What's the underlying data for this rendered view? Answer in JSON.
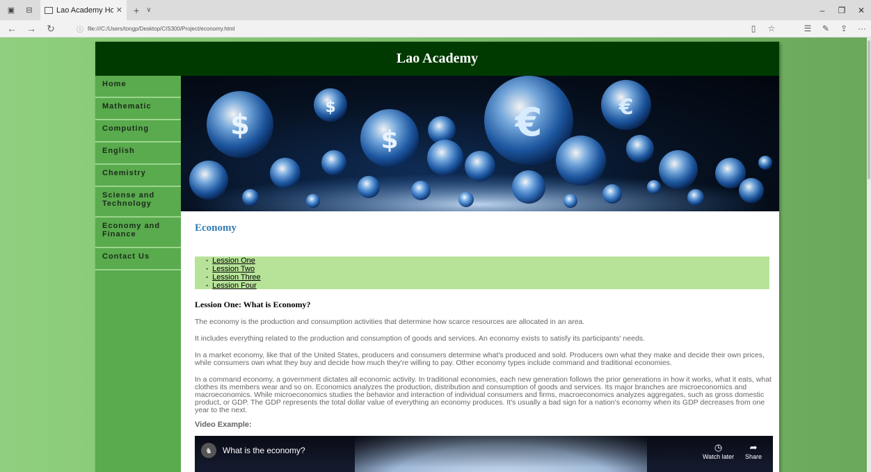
{
  "browser": {
    "tab_title": "Lao Academy Home Pag",
    "url": "file:///C:/Users/tongp/Desktop/CIS300/Project/economy.html"
  },
  "site": {
    "title": "Lao Academy"
  },
  "nav": [
    {
      "label": "Home"
    },
    {
      "label": "Mathematic"
    },
    {
      "label": "Computing"
    },
    {
      "label": "English"
    },
    {
      "label": "Chemistry"
    },
    {
      "label": "Sciense and Technology"
    },
    {
      "label": "Economy and Finance"
    },
    {
      "label": "Contact Us"
    }
  ],
  "page": {
    "title": "Economy",
    "lessons": [
      {
        "label": "Lession One"
      },
      {
        "label": "Lession Two"
      },
      {
        "label": "Lession Three"
      },
      {
        "label": "Lession Four"
      }
    ],
    "lesson_heading": "Lession One: What is Economy?",
    "paragraphs": [
      "The economy is the production and consumption activities that determine how scarce resources are allocated in an area.",
      "It includes everything related to the production and consumption of goods and services. An economy exists to satisfy its participants' needs.",
      "In a market economy, like that of the United States, producers and consumers determine what's produced and sold. Producers own what they make and decide their own prices, while consumers own what they buy and decide how much they're willing to pay. Other economy types include command and traditional economies.",
      "In a command economy, a government dictates all economic activity. In traditional economies, each new generation follows the prior generations in how it works, what it eats, what clothes its members wear and so on. Economics analyzes the production, distribution and consumption of goods and services. Its major branches are microeconomics and macroeconomics. While microeconomics studies the behavior and interaction of individual consumers and firms, macroeconomics analyzes aggregates, such as gross domestic product, or GDP. The GDP represents the total dollar value of everything an economy produces. It's usually a bad sign for a nation's economy when its GDP decreases from one year to the next."
    ],
    "video_label": "Video Example:",
    "video": {
      "title": "What is the economy?",
      "watch_later": "Watch later",
      "share": "Share"
    }
  },
  "colors": {
    "header_bg": "#003a00",
    "sidebar_bg": "#5aaa4e",
    "lesson_box_bg": "#b7e399",
    "title_blue": "#2f7bb3"
  }
}
